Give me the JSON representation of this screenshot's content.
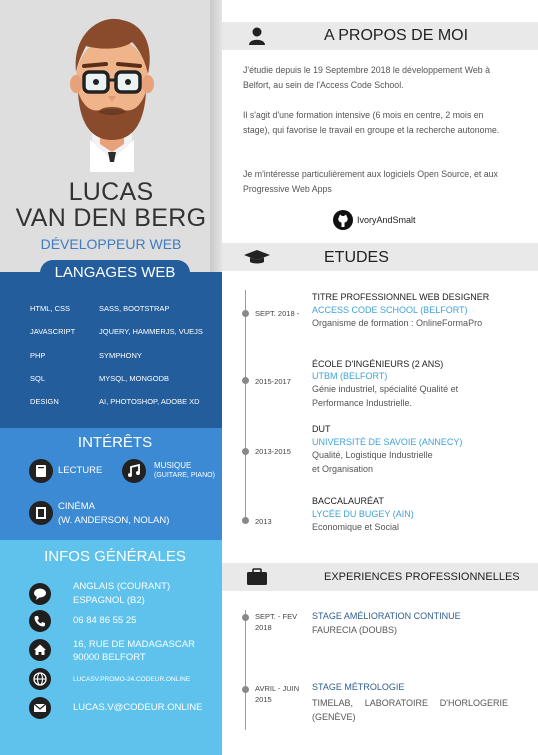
{
  "profile": {
    "first_name": "LUCAS",
    "last_name": "VAN DEN BERG",
    "role": "DÉVELOPPEUR WEB"
  },
  "languages": {
    "title": "LANGAGES WEB",
    "items": [
      {
        "left": "HTML, CSS",
        "right": "SASS, BOOTSTRAP"
      },
      {
        "left": "JAVASCRIPT",
        "right": "JQUERY, HAMMERJS, VUEJS"
      },
      {
        "left": "PHP",
        "right": "SYMPHONY"
      },
      {
        "left": "SQL",
        "right": "MYSQL, MONGODB"
      },
      {
        "left": "DESIGN",
        "right": "AI, PHOTOSHOP, ADOBE XD"
      }
    ]
  },
  "interests": {
    "title": "INTÉRÊTS",
    "reading": "LECTURE",
    "music": "MUSIQUE",
    "music_detail": "(GUITARE, PIANO)",
    "cinema": "CINÉMA",
    "cinema_detail": "(W. ANDERSON, NOLAN)"
  },
  "info": {
    "title": "INFOS GÉNÉRALES",
    "lang1": "ANGLAIS (COURANT)",
    "lang2": "ESPAGNOL (B2)",
    "phone": "06 84 86 55 25",
    "address1": "16, RUE DE MADAGASCAR",
    "address2": "90000 BELFORT",
    "website": "LUCASV.PROMO-24.CODEUR.ONLINE",
    "email": "LUCAS.V@CODEUR.ONLINE"
  },
  "about": {
    "title": "A PROPOS DE MOI",
    "p1": "J'étudie depuis le 19 Septembre 2018 le développement Web à Belfort, au sein de l'Access Code School.",
    "p2": "Il s'agit d'une formation intensive (6 mois en centre, 2 mois en stage), qui favorise le travail en groupe et la recherche autonome.",
    "p3": "Je m'intéresse particulièrement aux logiciels Open Source, et aux Progressive Web Apps",
    "github": "IvoryAndSmalt"
  },
  "studies": {
    "title": "ETUDES",
    "items": [
      {
        "date": "SEPT. 2018 -",
        "title": "TITRE PROFESSIONNEL WEB DESIGNER",
        "school": "ACCESS CODE SCHOOL (BELFORT)",
        "desc": "Organisme de formation : OnlineFormaPro"
      },
      {
        "date": "2015-2017",
        "title": "ÉCOLE D'INGÉNIEURS (2 ANS)",
        "school": "UTBM (BELFORT)",
        "desc": "Génie industriel, spécialité Qualité et Performance Industrielle."
      },
      {
        "date": "2013-2015",
        "title": "DUT",
        "school": "UNIVERSITÉ DE SAVOIE (ANNECY)",
        "desc": "Qualité, Logistique Industrielle et Organisation"
      },
      {
        "date": "2013",
        "title": "BACCALAURÉAT",
        "school": "LYCÉE DU BUGEY (AIN)",
        "desc": "Economique et Social"
      }
    ]
  },
  "experience": {
    "title": "EXPERIENCES PROFESSIONNELLES",
    "items": [
      {
        "date1": "SEPT. - FEV",
        "date2": "2018",
        "title": "STAGE AMÉLIORATION CONTINUE",
        "desc": "FAURECIA (DOUBS)"
      },
      {
        "date1": "AVRIL - JUIN",
        "date2": "2015",
        "title": "STAGE MÉTROLOGIE",
        "desc": "TIMELAB, LABORATOIRE D'HORLOGERIE (GENÈVE)"
      }
    ]
  },
  "colors": {
    "lang_panel": "#245d9c",
    "interest_panel": "#3c8ad4",
    "info_panel": "#5ec2ec",
    "accent": "#3fa2dc"
  }
}
